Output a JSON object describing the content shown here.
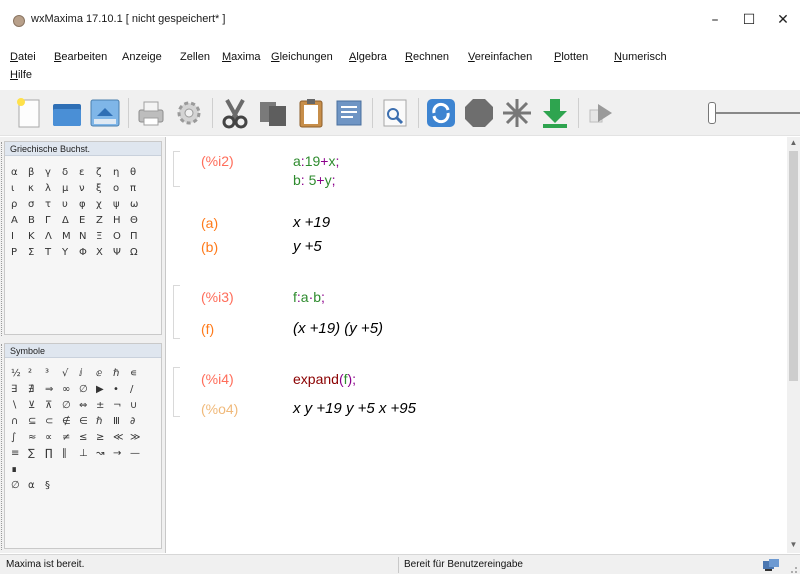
{
  "window": {
    "title": "wxMaxima 17.10.1 [ nicht gespeichert* ]",
    "minimize": "–",
    "maximize": "☐",
    "close": "✕"
  },
  "menu": {
    "items": [
      {
        "label": "Datei",
        "ul": "D",
        "rest": "atei"
      },
      {
        "label": "Bearbeiten",
        "ul": "B",
        "rest": "earbeiten"
      },
      {
        "label": "Anzeige",
        "ul": "",
        "rest": "Anzeige"
      },
      {
        "label": "Zellen",
        "ul": "",
        "rest": "Zellen"
      },
      {
        "label": "Maxima",
        "ul": "M",
        "rest": "axima"
      },
      {
        "label": "Gleichungen",
        "ul": "G",
        "rest": "leichungen"
      },
      {
        "label": "Algebra",
        "ul": "A",
        "rest": "lgebra"
      },
      {
        "label": "Rechnen",
        "ul": "R",
        "rest": "echnen"
      },
      {
        "label": "Vereinfachen",
        "ul": "V",
        "rest": "ereinfachen"
      },
      {
        "label": "Plotten",
        "ul": "P",
        "rest": "lotten"
      },
      {
        "label": "Numerisch",
        "ul": "N",
        "rest": "umerisch"
      },
      {
        "label": "Hilfe",
        "ul": "H",
        "rest": "ilfe"
      }
    ]
  },
  "toolbar": {
    "icons": [
      "new-document-icon",
      "open-folder-icon",
      "save-icon",
      "print-icon",
      "settings-gear-icon",
      "cut-icon",
      "copy-icon",
      "paste-icon",
      "select-all-icon",
      "find-icon",
      "restart-maxima-icon",
      "interrupt-icon",
      "follow-icon",
      "evaluate-all-icon",
      "animation-play-icon"
    ]
  },
  "greek_panel": {
    "title": "Griechische Buchst.",
    "rows": [
      [
        "α",
        "β",
        "γ",
        "δ",
        "ε",
        "ζ",
        "η",
        "θ"
      ],
      [
        "ι",
        "κ",
        "λ",
        "μ",
        "ν",
        "ξ",
        "ο",
        "π"
      ],
      [
        "ρ",
        "σ",
        "τ",
        "υ",
        "φ",
        "χ",
        "ψ",
        "ω"
      ],
      [
        "Α",
        "Β",
        "Γ",
        "Δ",
        "Ε",
        "Ζ",
        "Η",
        "Θ"
      ],
      [
        "Ι",
        "Κ",
        "Λ",
        "Μ",
        "Ν",
        "Ξ",
        "Ο",
        "Π"
      ],
      [
        "Ρ",
        "Σ",
        "Τ",
        "Υ",
        "Φ",
        "Χ",
        "Ψ",
        "Ω"
      ]
    ]
  },
  "symbols_panel": {
    "title": "Symbole",
    "rows": [
      [
        "½",
        "²",
        "³",
        "√",
        "ⅈ",
        "ⅇ",
        "ℏ",
        "∊"
      ],
      [
        "∃",
        "∄",
        "⇒",
        "∞",
        "∅",
        "▶",
        "•",
        "/"
      ],
      [
        "∖",
        "⊻",
        "⊼",
        "∅",
        "⇔",
        "±",
        "¬",
        "∪"
      ],
      [
        "∩",
        "⊆",
        "⊂",
        "∉",
        "∈",
        "ℏ",
        "Ⅲ",
        "∂"
      ],
      [
        "∫",
        "≈",
        "∝",
        "≠",
        "≤",
        "≥",
        "≪",
        "≫"
      ],
      [
        "≡",
        "∑",
        "∏",
        "∥",
        "⊥",
        "↝",
        "→",
        "—"
      ],
      [
        "∎",
        "",
        "",
        "",
        "",
        "",
        "",
        ""
      ],
      [
        "∅",
        "⍺",
        "§",
        "",
        "",
        "",
        "",
        ""
      ]
    ]
  },
  "worksheet": {
    "cells": [
      {
        "label": "(%i2)",
        "lines": [
          [
            "a",
            ":",
            "19",
            "+",
            "x",
            ";"
          ],
          [
            "b",
            ":",
            " 5",
            "+",
            "y",
            ";"
          ]
        ]
      },
      {
        "label": "(a)",
        "output": "x +19"
      },
      {
        "label": "(b)",
        "output": "y +5"
      },
      {
        "label": "(%i3)",
        "lines": [
          [
            "f",
            ":",
            "a",
            "·",
            "b",
            ";"
          ]
        ]
      },
      {
        "label": "(f)",
        "output": "(x +19) (y +5)"
      },
      {
        "label": "(%i4)",
        "fn": "expand",
        "arg": "f",
        "tail": ");"
      },
      {
        "label": "(%o4)",
        "output": "x y +19 y +5 x +95"
      }
    ]
  },
  "status": {
    "left": "Maxima ist bereit.",
    "middle": "Bereit für Benutzereingabe"
  },
  "colors": {
    "input_label": "#ff6d5a",
    "output_label": "#ff7a1a",
    "output_prompt": "#f0b97a",
    "code_green": "#2e8b2e",
    "function": "#8b0000"
  }
}
